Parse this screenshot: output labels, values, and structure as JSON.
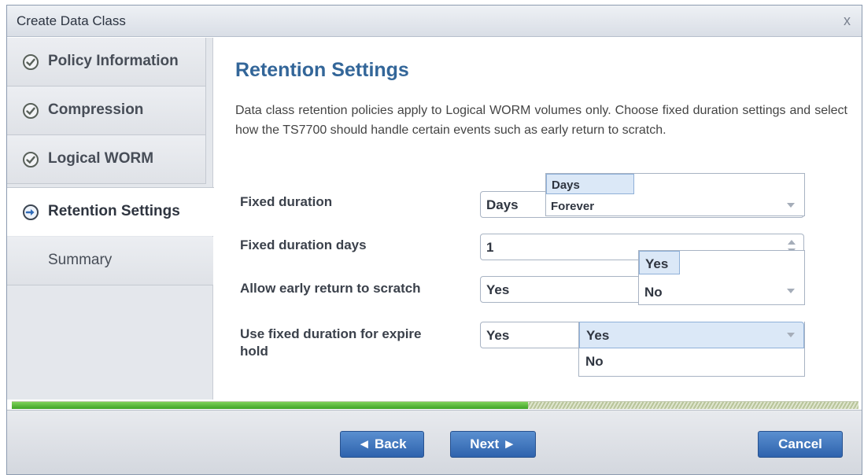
{
  "dialog": {
    "title": "Create Data Class",
    "close_label": "x"
  },
  "sidebar": {
    "items": [
      {
        "label": "Policy Information",
        "state": "done"
      },
      {
        "label": "Compression",
        "state": "done"
      },
      {
        "label": "Logical WORM",
        "state": "done"
      },
      {
        "label": "Retention Settings",
        "state": "active"
      },
      {
        "label": "Summary",
        "state": "pending"
      }
    ]
  },
  "main": {
    "heading": "Retention Settings",
    "description": "Data class retention policies apply to Logical WORM volumes only. Choose fixed duration settings and select how the TS7700 should handle certain events such as early return to scratch.",
    "fields": {
      "fixed_duration": {
        "label": "Fixed duration",
        "value": "Days",
        "options": [
          "Days",
          "Forever"
        ]
      },
      "fixed_duration_days": {
        "label": "Fixed duration days",
        "value": "1"
      },
      "early_return": {
        "label": "Allow early return to scratch",
        "value": "Yes",
        "options": [
          "Yes",
          "No"
        ]
      },
      "expire_hold": {
        "label": "Use fixed duration for expire hold",
        "value": "Yes",
        "options": [
          "Yes",
          "No"
        ]
      }
    }
  },
  "progress": {
    "fraction": 0.61
  },
  "footer": {
    "back_label": "◄ Back",
    "next_label": "Next ►",
    "cancel_label": "Cancel"
  },
  "colors": {
    "heading": "#336699",
    "button": "#2e63ad",
    "progress": "#3ea326",
    "check_icon": "#4a5a48",
    "arrow_icon": "#2f6bb8"
  }
}
